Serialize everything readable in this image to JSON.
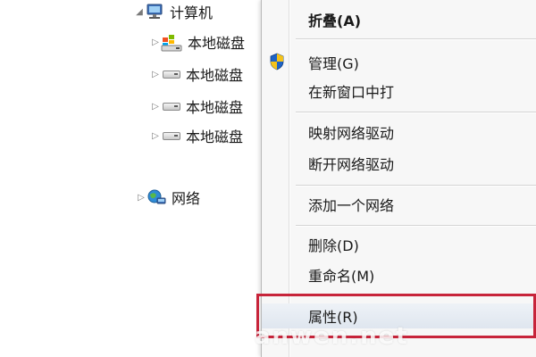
{
  "tree": {
    "computer": {
      "label": "计算机",
      "expanded": true
    },
    "drives": [
      {
        "label": "本地磁盘",
        "icon": "system-drive-icon"
      },
      {
        "label": "本地磁盘",
        "icon": "hard-drive-icon"
      },
      {
        "label": "本地磁盘",
        "icon": "hard-drive-icon"
      },
      {
        "label": "本地磁盘",
        "icon": "hard-drive-icon"
      }
    ],
    "network": {
      "label": "网络",
      "icon": "network-globe-icon"
    }
  },
  "menu": {
    "collapse": "折叠(A)",
    "manage": "管理(G)",
    "open_new_window": "在新窗口中打",
    "map_network_drive": "映射网络驱动",
    "disconnect_network_drive": "断开网络驱动",
    "add_network_location": "添加一个网络",
    "delete": "删除(D)",
    "rename": "重命名(M)",
    "properties": "属性(R)"
  },
  "colors": {
    "highlight_border": "#c7243a",
    "menu_background": "#f7f7f7"
  },
  "watermark": "anwen.net"
}
